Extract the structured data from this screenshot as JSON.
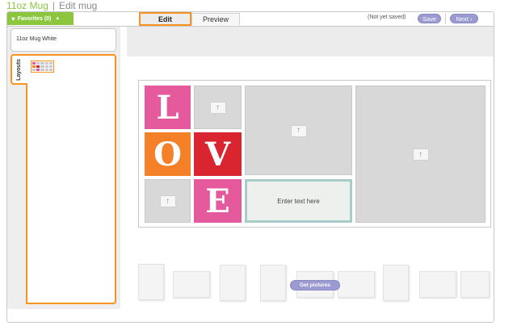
{
  "breadcrumb": {
    "product": "11oz Mug",
    "separator": "|",
    "page": "Edit mug"
  },
  "favorites": {
    "label": "Favorites (0)",
    "icon": "heart-icon",
    "caret_icon": "caret-up-icon"
  },
  "tabs": {
    "edit": "Edit",
    "preview": "Preview",
    "active": "Edit"
  },
  "status": "(Not yet saved)",
  "actions": {
    "save": "Save",
    "next": "Next",
    "next_icon": "chevron-right-icon"
  },
  "sidebar": {
    "product_option": "11oz Mug White",
    "layouts_tab": "Layouts"
  },
  "canvas": {
    "letters": [
      "L",
      "O",
      "V",
      "E"
    ],
    "text_placeholder": "Enter text here",
    "upload_icon": "upload-arrow-icon"
  },
  "photo_strip": {
    "button": "Get pictures"
  },
  "colors": {
    "accent_green": "#8cc63f",
    "accent_orange": "#f7931e",
    "button_purple": "#9b9bd1",
    "letter_pink": "#e45a9c",
    "letter_orange": "#f48127",
    "letter_red": "#d9252f",
    "text_frame": "#a7cdc8"
  }
}
